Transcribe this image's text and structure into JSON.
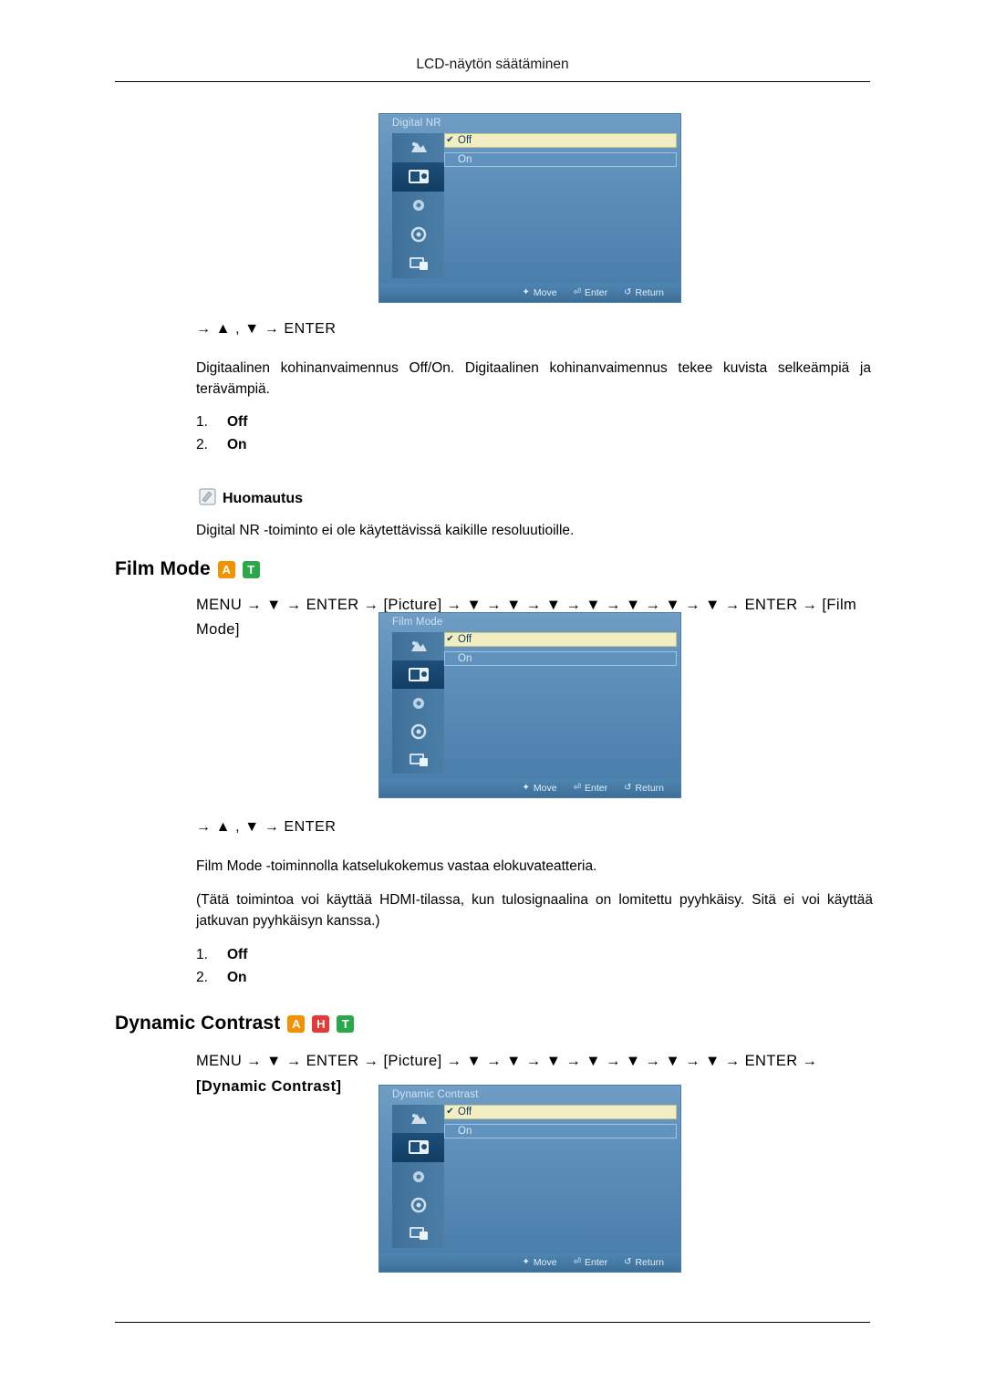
{
  "header": {
    "title": "LCD-näytön säätäminen"
  },
  "osd_common": {
    "footer": {
      "move": "Move",
      "enter": "Enter",
      "return": "Return"
    },
    "options": {
      "off": "Off",
      "on": "On"
    },
    "check": "✔"
  },
  "section_digital_nr": {
    "osd_title": "Digital NR",
    "path": "→ ▲ , ▼ → ENTER",
    "paragraph": "Digitaalinen kohinanvaimennus Off/On. Digitaalinen kohinanvaimennus tekee kuvista selkeämpiä ja terävämpiä.",
    "list": [
      {
        "n": "1.",
        "v": "Off"
      },
      {
        "n": "2.",
        "v": "On"
      }
    ],
    "note_title": "Huomautus",
    "note_text": "Digital NR -toiminto ei ole käytettävissä kaikille resoluutioille."
  },
  "section_film_mode": {
    "heading": "Film Mode",
    "tags": [
      "A",
      "T"
    ],
    "menu_path": "MENU → ▼ → ENTER → [Picture] → ▼ → ▼ → ▼ → ▼ → ▼ → ▼ → ▼ → ENTER → [Film Mode]",
    "osd_title": "Film Mode",
    "path": "→ ▲ , ▼ → ENTER",
    "paragraph1": "Film Mode -toiminnolla katselukokemus vastaa elokuvateatteria.",
    "paragraph2": "(Tätä toimintoa voi käyttää HDMI-tilassa, kun tulosignaalina on lomitettu pyyhkäisy. Sitä ei voi käyttää jatkuvan pyyhkäisyn kanssa.)",
    "list": [
      {
        "n": "1.",
        "v": "Off"
      },
      {
        "n": "2.",
        "v": "On"
      }
    ]
  },
  "section_dynamic_contrast": {
    "heading": "Dynamic Contrast",
    "tags": [
      "A",
      "H",
      "T"
    ],
    "menu_path_line1": "MENU → ▼ → ENTER → [Picture] → ▼ → ▼ → ▼ → ▼ → ▼ → ▼ → ▼ → ENTER →",
    "menu_path_line2": "[Dynamic Contrast]",
    "osd_title": "Dynamic Contrast"
  }
}
